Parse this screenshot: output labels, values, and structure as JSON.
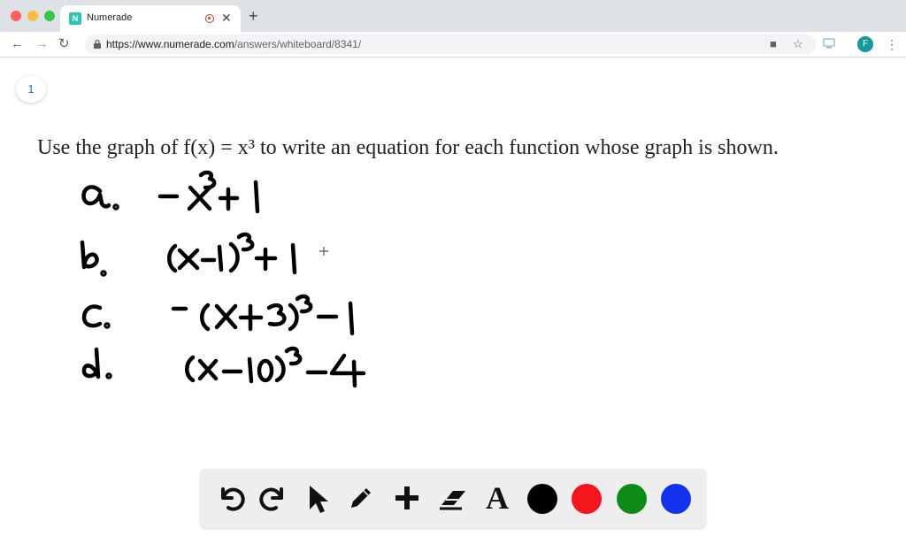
{
  "browser": {
    "tab_title": "Numerade",
    "favicon_letter": "N",
    "url_host": "https://www.numerade.com",
    "url_path": "/answers/whiteboard/8341/",
    "profile_initial": "F"
  },
  "whiteboard": {
    "page_number": "1",
    "problem_text": "Use the graph of f(x) = x³ to write an equation for each function whose graph is shown.",
    "answers": [
      {
        "label": "a.",
        "expression": "−x³+1"
      },
      {
        "label": "b.",
        "expression": "(x−1)³+1"
      },
      {
        "label": "c.",
        "expression": "−(x+3)³−1"
      },
      {
        "label": "d.",
        "expression": "(x−10)³−4"
      }
    ]
  },
  "toolbar": {
    "tools": [
      "undo-icon",
      "redo-icon",
      "pointer-icon",
      "pencil-icon",
      "plus-icon",
      "eraser-icon",
      "text-tool-icon"
    ],
    "text_tool_glyph": "A",
    "colors": [
      "#000000",
      "#f5151d",
      "#0e8a16",
      "#1232f0"
    ]
  }
}
